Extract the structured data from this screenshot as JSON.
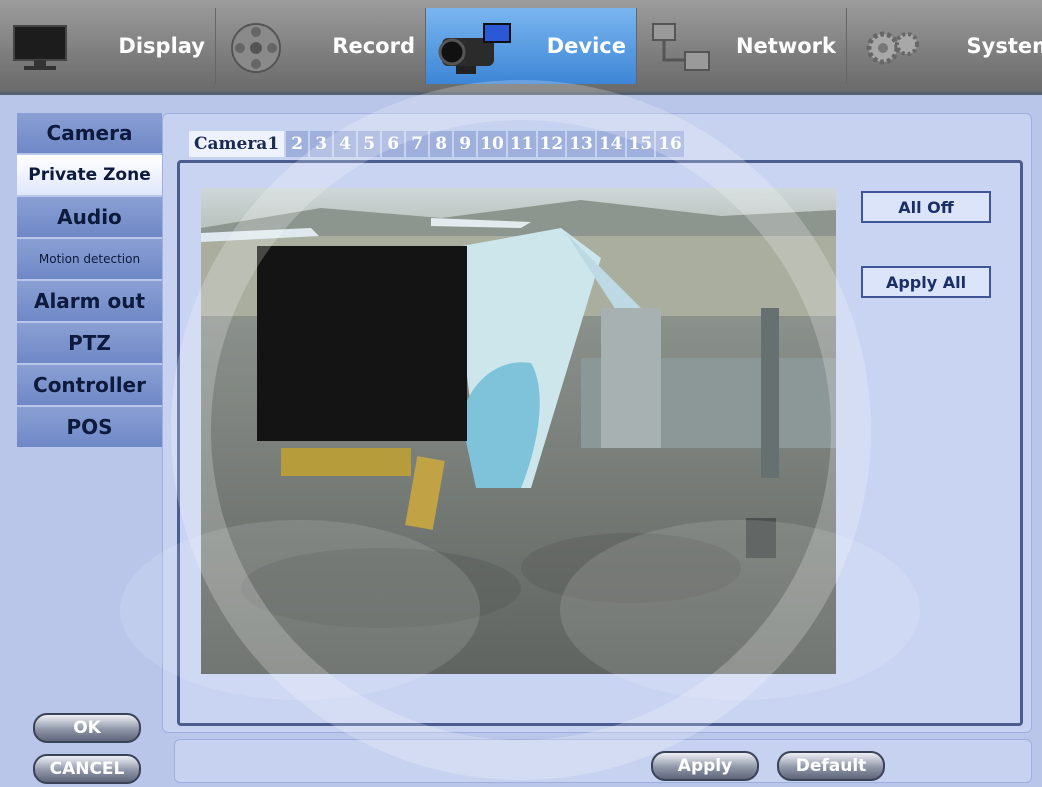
{
  "nav": {
    "tabs": [
      {
        "label": "Display",
        "icon": "monitor-icon",
        "active": false
      },
      {
        "label": "Record",
        "icon": "film-reel-icon",
        "active": false
      },
      {
        "label": "Device",
        "icon": "camcorder-icon",
        "active": true
      },
      {
        "label": "Network",
        "icon": "network-icon",
        "active": false
      },
      {
        "label": "System",
        "icon": "gears-icon",
        "active": false
      }
    ]
  },
  "sidebar": {
    "items": [
      {
        "label": "Camera"
      },
      {
        "label": "Private Zone"
      },
      {
        "label": "Audio"
      },
      {
        "label": "Motion detection"
      },
      {
        "label": "Alarm out"
      },
      {
        "label": "PTZ"
      },
      {
        "label": "Controller"
      },
      {
        "label": "POS"
      }
    ],
    "active_index": 1
  },
  "camera_tabs": [
    "Camera1",
    "2",
    "3",
    "4",
    "5",
    "6",
    "7",
    "8",
    "9",
    "10",
    "11",
    "12",
    "13",
    "14",
    "15",
    "16"
  ],
  "buttons": {
    "all_off": "All Off",
    "apply_all": "Apply All",
    "ok": "OK",
    "cancel": "CANCEL",
    "apply": "Apply",
    "default": "Default"
  },
  "colors": {
    "active_tab": "#3d86d6",
    "background": "#b9c6ea",
    "mask": "#141414"
  }
}
